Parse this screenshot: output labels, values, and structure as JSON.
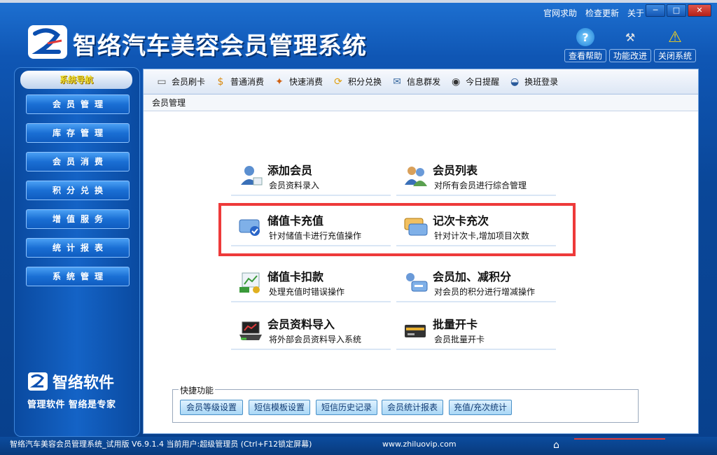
{
  "header": {
    "title": "智络汽车美容会员管理系统",
    "top_menu": [
      "官网求助",
      "检查更新",
      "关于"
    ],
    "buttons": [
      {
        "label": "查看帮助",
        "icon": "help-icon"
      },
      {
        "label": "功能改进",
        "icon": "tools-icon"
      },
      {
        "label": "关闭系统",
        "icon": "warning-icon"
      }
    ]
  },
  "sidebar": {
    "title": "系统导航",
    "items": [
      "会员管理",
      "库存管理",
      "会员消费",
      "积分兑换",
      "增值服务",
      "统计报表",
      "系统管理"
    ],
    "brand_name": "智络软件",
    "brand_slogan": "管理软件 智络是专家"
  },
  "toolbar": [
    {
      "label": "会员刷卡",
      "icon": "card-reader-icon"
    },
    {
      "label": "普通消费",
      "icon": "money-bag-icon"
    },
    {
      "label": "快速消费",
      "icon": "fast-consume-icon"
    },
    {
      "label": "积分兑换",
      "icon": "exchange-icon"
    },
    {
      "label": "信息群发",
      "icon": "mail-icon"
    },
    {
      "label": "今日提醒",
      "icon": "clock-icon"
    },
    {
      "label": "换班登录",
      "icon": "login-icon"
    }
  ],
  "section_title": "会员管理",
  "cards": [
    {
      "title": "添加会员",
      "desc": "会员资料录入",
      "icon": "add-member-icon"
    },
    {
      "title": "会员列表",
      "desc": "对所有会员进行综合管理",
      "icon": "member-list-icon"
    },
    {
      "title": "储值卡充值",
      "desc": "针对储值卡进行充值操作",
      "icon": "stored-card-recharge-icon"
    },
    {
      "title": "记次卡充次",
      "desc": "针对计次卡,增加项目次数",
      "icon": "count-card-icon"
    },
    {
      "title": "储值卡扣款",
      "desc": "处理充值时错误操作",
      "icon": "deduction-icon"
    },
    {
      "title": "会员加、减积分",
      "desc": "对会员的积分进行增减操作",
      "icon": "points-adjust-icon"
    },
    {
      "title": "会员资料导入",
      "desc": "将外部会员资料导入系统",
      "icon": "import-icon"
    },
    {
      "title": "批量开卡",
      "desc": "会员批量开卡",
      "icon": "batch-card-icon"
    }
  ],
  "quick": {
    "label": "快捷功能",
    "buttons": [
      "会员等级设置",
      "短信模板设置",
      "短信历史记录",
      "会员统计报表",
      "充值/充次统计"
    ]
  },
  "status": {
    "text": "智络汽车美容会员管理系统_试用版 V6.9.1.4 当前用户:超级管理员 (Ctrl+F12锁定屏幕)",
    "url": "www.zhiluovip.com"
  },
  "colors": {
    "accent": "#0f56b4",
    "highlight": "#ee3a3a",
    "nav_title": "#f0e030"
  }
}
